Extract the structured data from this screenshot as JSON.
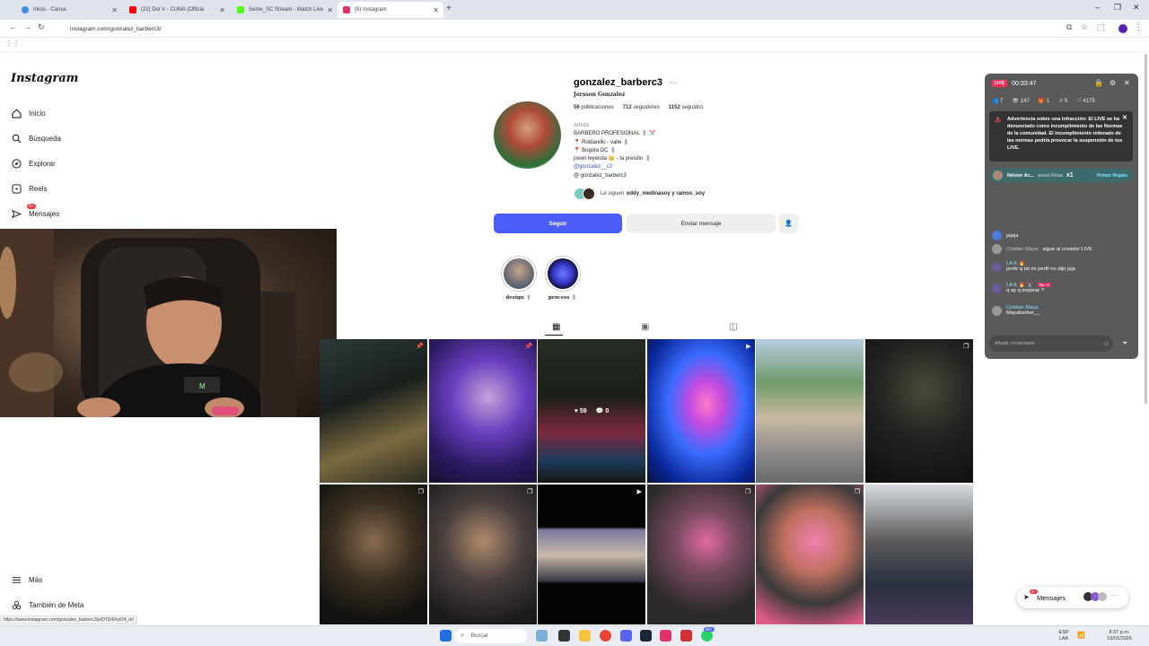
{
  "browser": {
    "tabs": [
      {
        "title": "Inicio - Canva",
        "color": "#3f8ee6"
      },
      {
        "title": "(22) Doi V - CUMA (Officia",
        "color": "#ff0000"
      },
      {
        "title": "Seme_SC Stream - Watch Live",
        "color": "#53fc18"
      },
      {
        "title": "(8) Instagram",
        "color": "#e1306c"
      }
    ],
    "url": "instagram.com/gonzalez_barberc3/",
    "status_url": "https://www.instagram.com/gonzalez_barberc3/p/DTi342vzD4_m/"
  },
  "sidebar": {
    "logo": "Instagram",
    "items": [
      {
        "label": "Inicio",
        "icon": "home-icon"
      },
      {
        "label": "Búsqueda",
        "icon": "search-icon"
      },
      {
        "label": "Explorar",
        "icon": "compass-icon"
      },
      {
        "label": "Reels",
        "icon": "reels-icon"
      },
      {
        "label": "Mensajes",
        "icon": "messenger-icon"
      }
    ],
    "messages_badge": "9+",
    "more": "Más",
    "meta": "También de Meta"
  },
  "profile": {
    "username": "gonzalez_barberc3",
    "more_icon": "···",
    "full_name": "Jersson Gonzalez",
    "stats": {
      "posts": "56",
      "posts_label": "publicaciones",
      "followers": "712",
      "followers_label": "seguidores",
      "following": "1152",
      "following_label": "seguidos"
    },
    "bio": {
      "category": "Artista",
      "line1": "BARBERO PROFESIONAL 💈 ✂️",
      "line2": "📍 Roldanillo - valle 💈",
      "line3": "📍 Bogota DC 💈",
      "line4": "joven leyenda 👑 - la presión 💈",
      "handle": "@gonzalez__c3",
      "threads": "gonzalez_barberc3"
    },
    "followed_by_prefix": "Le siguen",
    "followed_by": "eddy_medinasoy y ramos_soy",
    "follow_button": "Seguir",
    "message_button": "Enviar mensaje",
    "highlights": [
      {
        "label": "design 💈"
      },
      {
        "label": "process 💈"
      }
    ]
  },
  "posts": {
    "hover_likes": "59",
    "hover_comments": "0"
  },
  "live": {
    "badge": "LIVE",
    "time": "00:33:47",
    "stats": {
      "people": "7",
      "viewers": "147",
      "gifts": "1",
      "shares": "5",
      "likes": "4179"
    },
    "warning": "Advertencia sobre una infracción: El LIVE se ha denunciado como incumplimiento de las Normas de la comunidad. El incumplimiento reiterado de las normas podría provocar la suspensión de tus LIVE.",
    "gift": {
      "user": "Néstor Ac...",
      "text": "envió Rosa",
      "count": "x1",
      "tag": "Primer Regalo"
    },
    "comments": [
      {
        "name": "",
        "text": "jajaja"
      },
      {
        "name": "Cristian Maya",
        "text": "sigue al creador LIVE"
      },
      {
        "name": "LA K 🔥 ",
        "text": "profe q tal mi perfil no dijo jaja"
      },
      {
        "name": "LA K 🔥 ✂️",
        "badge": "No. 3",
        "text": "q ay q mejorar ?"
      },
      {
        "name": "Cristian Maya",
        "text": "Mayabarber__"
      }
    ],
    "input_placeholder": "Añadir comentario"
  },
  "messages_pill": {
    "label": "Mensajes",
    "badge": "9+"
  },
  "taskbar": {
    "search": "Buscar",
    "lang": "ESP",
    "lang2": "LAA",
    "time": "8:37 p.m.",
    "date": "19/01/2026",
    "badge": "99+"
  }
}
